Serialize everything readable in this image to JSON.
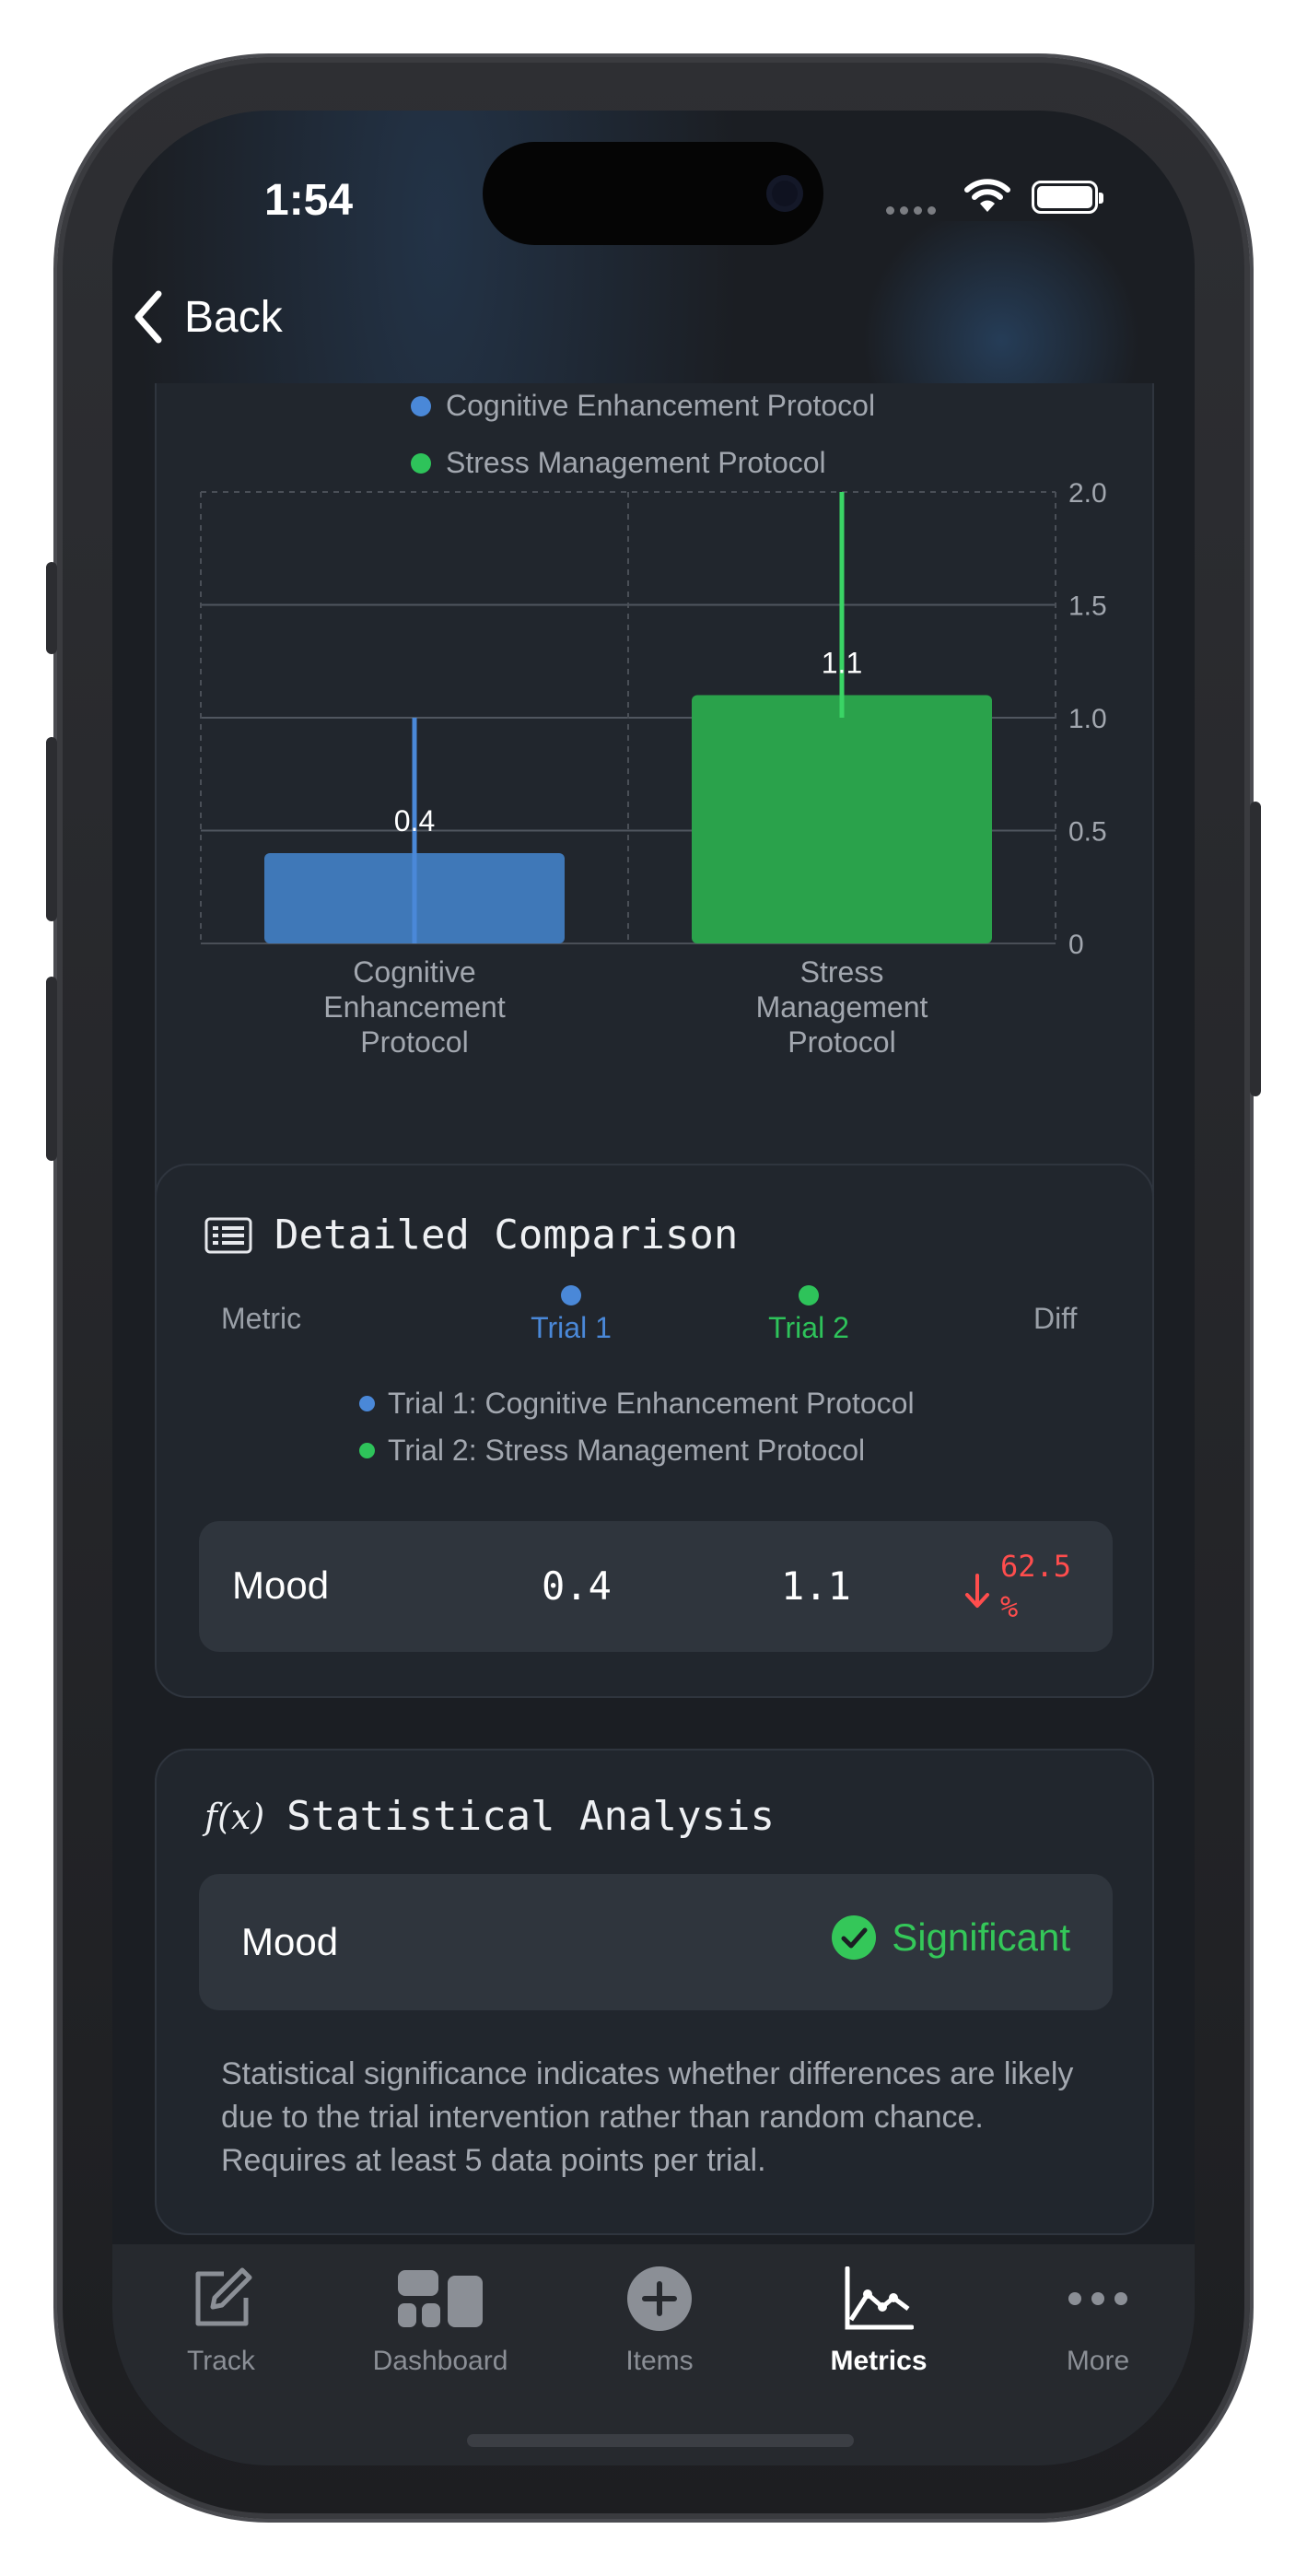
{
  "status_bar": {
    "time": "1:54"
  },
  "nav": {
    "back_label": "Back"
  },
  "colors": {
    "trial1": "#3f78b8",
    "trial2": "#2aa24b",
    "significant": "#34c759",
    "decrease": "#ff4d4d",
    "background": "#1b1e23"
  },
  "chart_data": {
    "type": "bar",
    "legend": [
      "Cognitive Enhancement Protocol",
      "Stress Management Protocol"
    ],
    "legend_placement": "top-center",
    "categories": [
      [
        "Cognitive",
        "Enhancement",
        "Protocol"
      ],
      [
        "Stress",
        "Management",
        "Protocol"
      ]
    ],
    "values": [
      0.4,
      1.1
    ],
    "data_labels": [
      "0.4",
      "1.1"
    ],
    "error_bars": [
      [
        0,
        1.0
      ],
      [
        1.0,
        2.0
      ]
    ],
    "y_ticks": [
      "2.0",
      "1.5",
      "1.0",
      "0.5",
      "0"
    ],
    "ylim": [
      0,
      2.0
    ],
    "y_axis_side": "right",
    "grid": true
  },
  "comparison": {
    "title": "Detailed Comparison",
    "icon": "list-icon",
    "headers": {
      "metric": "Metric",
      "trial1": "Trial 1",
      "trial2": "Trial 2",
      "diff": "Diff"
    },
    "legend": [
      "Trial 1: Cognitive Enhancement Protocol",
      "Trial 2: Stress Management Protocol"
    ],
    "row": {
      "metric": "Mood",
      "trial1": "0.4",
      "trial2": "1.1",
      "diff_value": "62.5",
      "diff_unit": "%",
      "diff_icon": "arrow-down-icon"
    }
  },
  "stats": {
    "title": "Statistical Analysis",
    "icon_text": "f(x)",
    "row": {
      "metric": "Mood",
      "result": "Significant",
      "icon": "checkmark-circle-icon"
    },
    "note": "Statistical significance indicates whether differences are likely due to the trial intervention rather than random chance. Requires at least 5 data points per trial."
  },
  "tabs": [
    {
      "label": "Track",
      "icon": "edit-icon"
    },
    {
      "label": "Dashboard",
      "icon": "dashboard-icon"
    },
    {
      "label": "Items",
      "icon": "plus-circle-icon"
    },
    {
      "label": "Metrics",
      "icon": "line-chart-icon",
      "active": true
    },
    {
      "label": "More",
      "icon": "ellipsis-icon"
    }
  ]
}
